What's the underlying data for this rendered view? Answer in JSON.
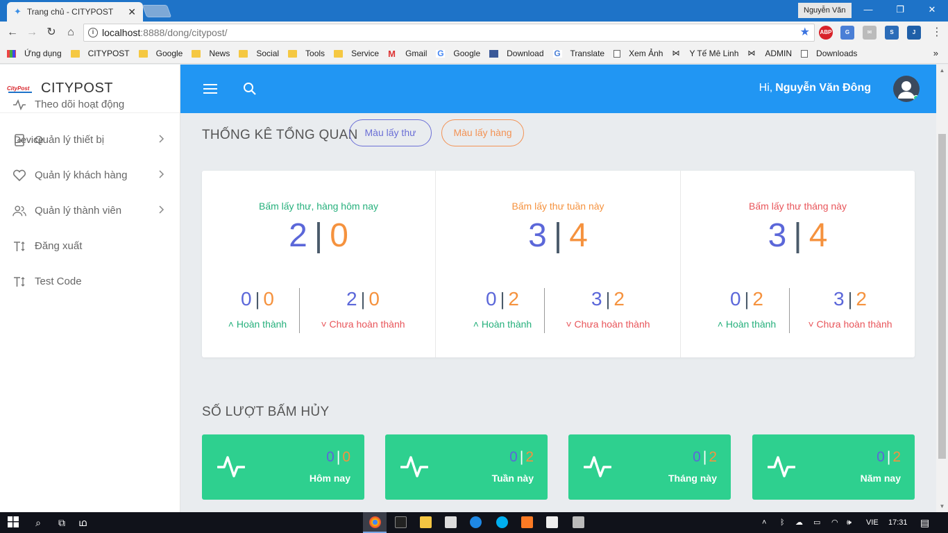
{
  "browser": {
    "tab_title": "Trang chủ - CITYPOST",
    "window_user": "Nguyễn Văn",
    "url_host": "localhost",
    "url_path": ":8888/dong/citypost/",
    "ext_abp": "ABP",
    "bookmarks": [
      {
        "label": "Ứng dụng",
        "icon": "grid"
      },
      {
        "label": "CITYPOST",
        "icon": "folder"
      },
      {
        "label": "Google",
        "icon": "folder"
      },
      {
        "label": "News",
        "icon": "folder"
      },
      {
        "label": "Social",
        "icon": "folder"
      },
      {
        "label": "Tools",
        "icon": "folder"
      },
      {
        "label": "Service",
        "icon": "folder"
      },
      {
        "label": "Gmail",
        "icon": "gmail"
      },
      {
        "label": "Google",
        "icon": "google"
      },
      {
        "label": "Download",
        "icon": "facebook"
      },
      {
        "label": "Translate",
        "icon": "translate"
      },
      {
        "label": "Xem Ảnh",
        "icon": "doc"
      },
      {
        "label": "Y Tế Mê Linh",
        "icon": "bow"
      },
      {
        "label": "ADMIN",
        "icon": "bow"
      },
      {
        "label": "Downloads",
        "icon": "doc"
      }
    ]
  },
  "sidebar": {
    "brand": "CITYPOST",
    "logo_text": "CityPost",
    "section": "Device",
    "items": [
      {
        "label": "Theo dõi hoạt động",
        "icon": "activity-icon",
        "has_children": false
      },
      {
        "label": "Quản lý thiết bị",
        "icon": "device-icon",
        "has_children": true
      },
      {
        "label": "Quản lý khách hàng",
        "icon": "heart-icon",
        "has_children": true
      },
      {
        "label": "Quản lý thành viên",
        "icon": "users-icon",
        "has_children": true
      },
      {
        "label": "Đăng xuất",
        "icon": "text-height-icon",
        "has_children": false
      },
      {
        "label": "Test Code",
        "icon": "text-height-icon",
        "has_children": false
      }
    ]
  },
  "header": {
    "greeting": "Hi,",
    "user_name": "Nguyễn Văn Đông"
  },
  "overview": {
    "title": "THỐNG KÊ TỔNG QUAN",
    "btn_letter": "Màu lấy thư",
    "btn_goods": "Màu lấy hàng",
    "done_label": "Hoàn thành",
    "not_done_label": "Chưa hoàn thành",
    "columns": [
      {
        "title": "Bấm lấy thư, hàng hôm nay",
        "title_color": "#26b07c",
        "letter": "2",
        "goods": "0",
        "done_letter": "0",
        "done_goods": "0",
        "pending_letter": "2",
        "pending_goods": "0"
      },
      {
        "title": "Bấm lấy thư tuần này",
        "title_color": "#f5923e",
        "letter": "3",
        "goods": "4",
        "done_letter": "0",
        "done_goods": "2",
        "pending_letter": "3",
        "pending_goods": "2"
      },
      {
        "title": "Bấm lấy thư tháng này",
        "title_color": "#e8555a",
        "letter": "3",
        "goods": "4",
        "done_letter": "0",
        "done_goods": "2",
        "pending_letter": "3",
        "pending_goods": "2"
      }
    ]
  },
  "cancel": {
    "title": "SỐ LƯỢT BẤM HỦY",
    "cards": [
      {
        "label": "Hôm nay",
        "letter": "0",
        "goods": "0"
      },
      {
        "label": "Tuần này",
        "letter": "0",
        "goods": "2"
      },
      {
        "label": "Tháng này",
        "letter": "0",
        "goods": "2"
      },
      {
        "label": "Năm nay",
        "letter": "0",
        "goods": "2"
      }
    ]
  },
  "colors": {
    "primary": "#2196f3",
    "letter": "#5b67d9",
    "goods": "#f5923e",
    "success": "#2ed08f",
    "danger": "#e8555a"
  },
  "taskbar": {
    "lang": "VIE",
    "time": "17:31"
  }
}
